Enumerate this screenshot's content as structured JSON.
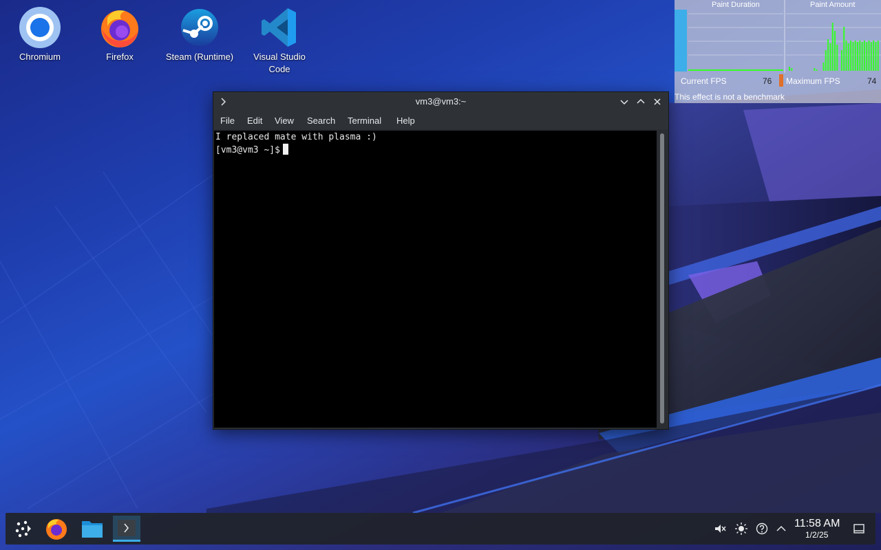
{
  "desktop_icons": [
    {
      "label": "Chromium",
      "icon": "chromium-icon"
    },
    {
      "label": "Firefox",
      "icon": "firefox-icon"
    },
    {
      "label": "Steam (Runtime)",
      "icon": "steam-icon"
    },
    {
      "label": "Visual Studio Code",
      "icon": "vscode-icon"
    }
  ],
  "fps_overlay": {
    "paint_duration_title": "Paint Duration",
    "paint_amount_title": "Paint Amount",
    "current_fps_label": "Current FPS",
    "current_fps_value": "76",
    "maximum_fps_label": "Maximum FPS",
    "maximum_fps_value": "74",
    "note": "This effect is not a benchmark"
  },
  "terminal": {
    "title": "vm3@vm3:~",
    "menu": [
      "File",
      "Edit",
      "View",
      "Search",
      "Terminal",
      "Help"
    ],
    "lines": [
      "I replaced mate with plasma :)",
      "[vm3@vm3 ~]$"
    ]
  },
  "taskbar": {
    "items": [
      "app-launcher-icon",
      "firefox-icon",
      "file-manager-icon",
      "terminal-icon"
    ],
    "active_item": "terminal-icon",
    "tray": [
      "volume-muted-icon",
      "brightness-icon",
      "help-icon",
      "chevron-up-icon"
    ],
    "clock_time": "11:58 AM",
    "clock_date": "1/2/25"
  },
  "colors": {
    "accent": "#3daee9",
    "fps_bar_green": "#33ff22",
    "fps_bar_blue": "#3daee9",
    "fps_marker_orange": "#e0702a"
  }
}
